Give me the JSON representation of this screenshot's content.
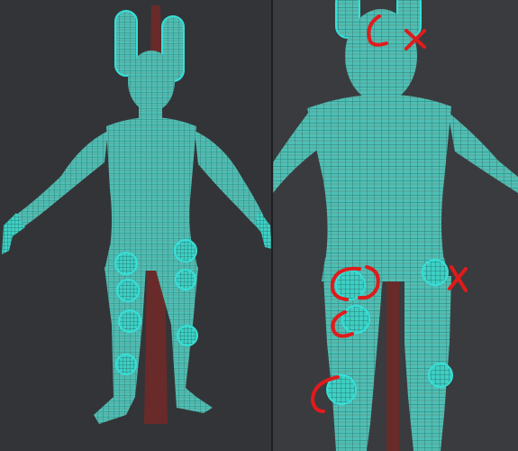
{
  "viewport": {
    "background": "#333437",
    "views": [
      {
        "name": "front-view",
        "model": "humanoid-wireframe-mesh",
        "markup": "none"
      },
      {
        "name": "closeup-view",
        "model": "humanoid-wireframe-mesh",
        "markup": "red-annotations"
      }
    ]
  },
  "colors": {
    "mesh_fill": "#4fbfb5",
    "mesh_wire": "#2a7c74",
    "mesh_edge_highlight": "#35e0d8",
    "bone": "#6e2a28",
    "annotation": "#e01b1b"
  },
  "annotations": {
    "count": 5,
    "marks": [
      {
        "name": "face-annotation",
        "shape": "c-curve-and-x"
      },
      {
        "name": "thigh-annotation",
        "shape": "c-curve-double"
      },
      {
        "name": "knee-annotation",
        "shape": "c-curve"
      },
      {
        "name": "shin-annotation",
        "shape": "c-curve"
      },
      {
        "name": "right-hip-annotation",
        "shape": "x-mark"
      }
    ]
  }
}
